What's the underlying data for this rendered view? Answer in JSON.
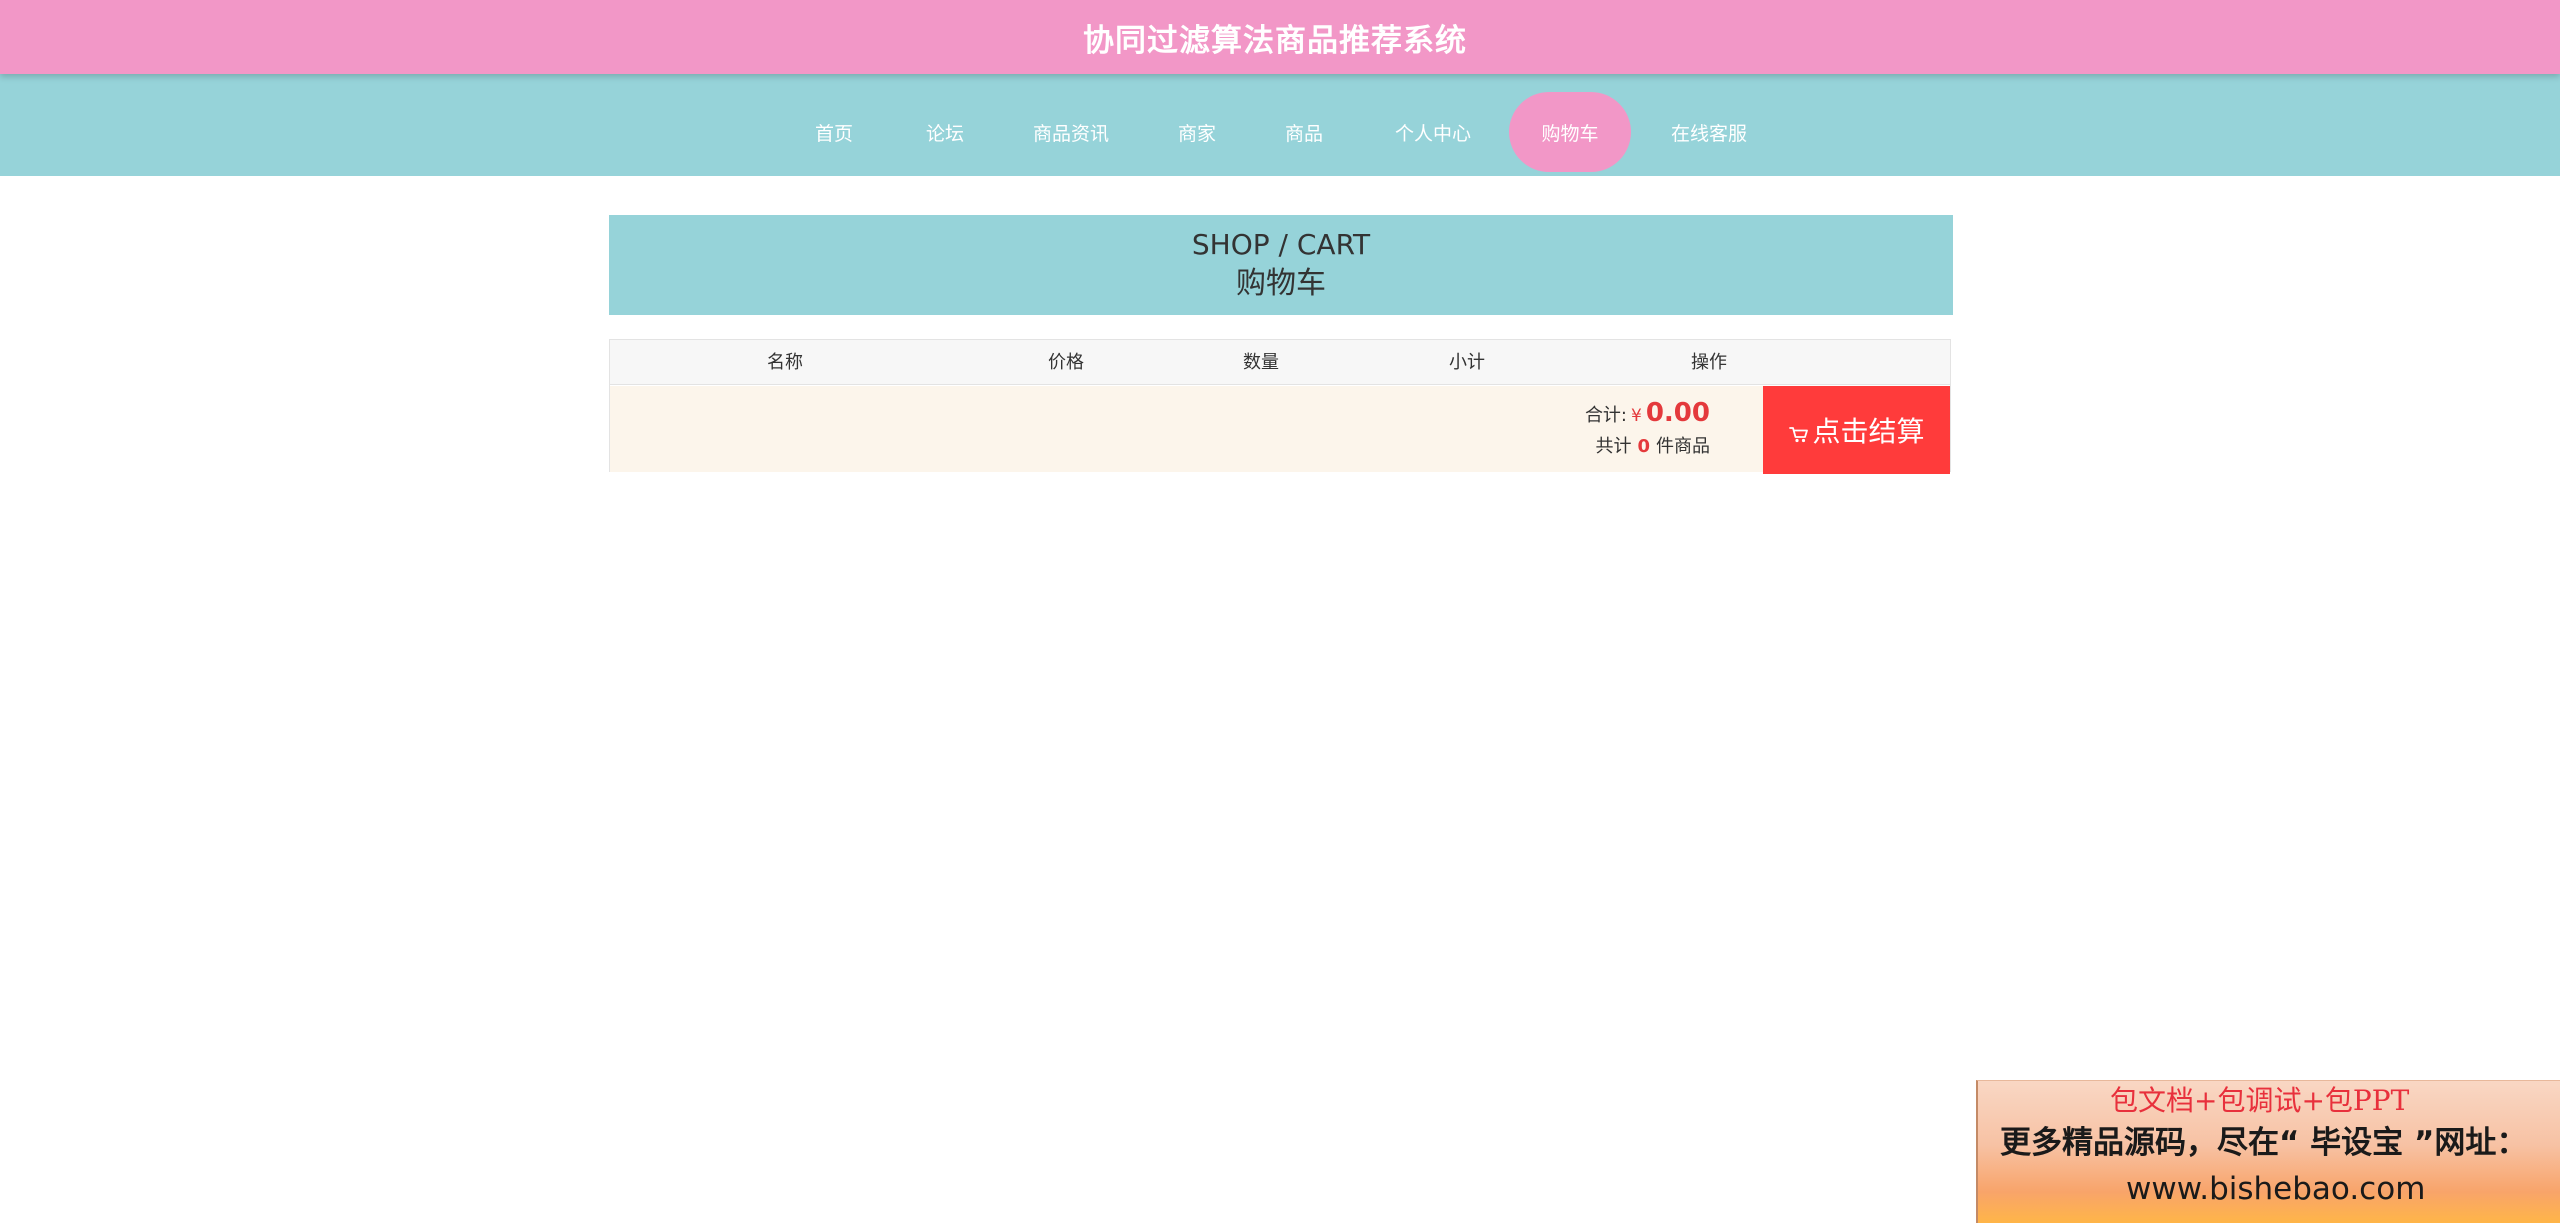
{
  "header": {
    "title": "协同过滤算法商品推荐系统"
  },
  "nav": {
    "items": [
      {
        "label": "首页"
      },
      {
        "label": "论坛"
      },
      {
        "label": "商品资讯"
      },
      {
        "label": "商家"
      },
      {
        "label": "商品"
      },
      {
        "label": "个人中心"
      },
      {
        "label": "购物车"
      },
      {
        "label": "在线客服"
      }
    ],
    "active_label": "购物车"
  },
  "banner": {
    "en": "SHOP / CART",
    "cn": "购物车"
  },
  "cart": {
    "columns": [
      "名称",
      "价格",
      "数量",
      "小计",
      "操作"
    ],
    "total_label": "合计:",
    "currency": "¥",
    "total_value": "0.00",
    "count_prefix": "共计",
    "count_value": "0",
    "count_suffix": "件商品",
    "checkout_label": "点击结算",
    "checkout_icon": "cart-icon"
  },
  "ad": {
    "line1": "包文档+包调试+包PPT",
    "line2": "更多精品源码，尽在“ 毕设宝 ”网址：",
    "line3": "www.bishebao.com"
  },
  "colors": {
    "header_bg": "#f297c7",
    "nav_bg": "#96d3d9",
    "nav_active_bg": "#f297c7",
    "checkout_bg": "#ff3b3b",
    "price_color": "#e4393c",
    "cart_footer_bg": "#fcf5eb"
  }
}
